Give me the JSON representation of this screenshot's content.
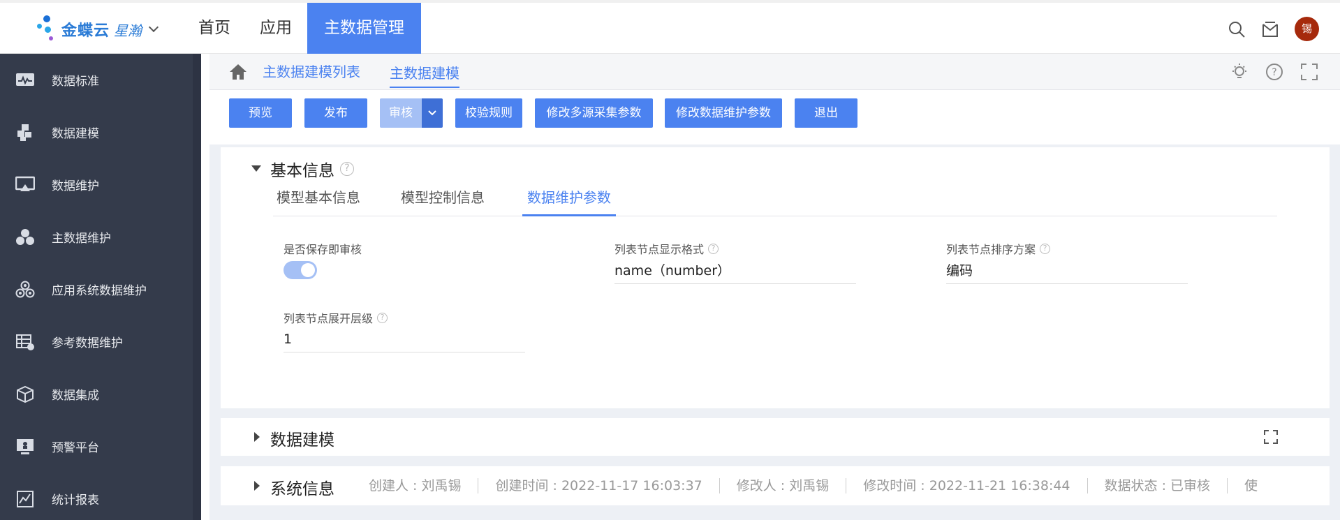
{
  "header": {
    "brand": "金蝶云",
    "brand_sub": "星瀚",
    "nav": [
      "首页",
      "应用",
      "主数据管理"
    ],
    "avatar_text": "锡"
  },
  "sidebar": {
    "items": [
      {
        "label": "数据标准",
        "icon": "monitor-wave-icon"
      },
      {
        "label": "数据建模",
        "icon": "blocks-icon"
      },
      {
        "label": "数据维护",
        "icon": "screen-icon"
      },
      {
        "label": "主数据维护",
        "icon": "cluster-icon"
      },
      {
        "label": "应用系统数据维护",
        "icon": "apps-cluster-icon"
      },
      {
        "label": "参考数据维护",
        "icon": "table-gear-icon"
      },
      {
        "label": "数据集成",
        "icon": "cube-icon"
      },
      {
        "label": "预警平台",
        "icon": "alert-screen-icon"
      },
      {
        "label": "统计报表",
        "icon": "chart-report-icon"
      }
    ]
  },
  "breadcrumb": {
    "items": [
      "主数据建模列表",
      "主数据建模"
    ]
  },
  "toolbar": {
    "preview": "预览",
    "publish": "发布",
    "audit": "审核",
    "validate": "校验规则",
    "multi_source": "修改多源采集参数",
    "maintain_params": "修改数据维护参数",
    "exit": "退出"
  },
  "basic_info": {
    "title": "基本信息",
    "tabs": [
      "模型基本信息",
      "模型控制信息",
      "数据维护参数"
    ],
    "fields": {
      "save_audit_label": "是否保存即审核",
      "save_audit_value": true,
      "display_format_label": "列表节点显示格式",
      "display_format_value": "name（number）",
      "sort_scheme_label": "列表节点排序方案",
      "sort_scheme_value": "编码",
      "expand_level_label": "列表节点展开层级",
      "expand_level_value": "1"
    }
  },
  "data_modeling": {
    "title": "数据建模"
  },
  "system_info": {
    "title": "系统信息",
    "creator": "创建人 : 刘禹锡",
    "created": "创建时间 : 2022-11-17 16:03:37",
    "modifier": "修改人 : 刘禹锡",
    "modified": "修改时间 : 2022-11-21 16:38:44",
    "status": "数据状态 : 已审核",
    "truncated": "使"
  },
  "colors": {
    "accent": "#4b82f0",
    "sidebar_bg": "#343b4b",
    "avatar": "#a62a0c"
  }
}
